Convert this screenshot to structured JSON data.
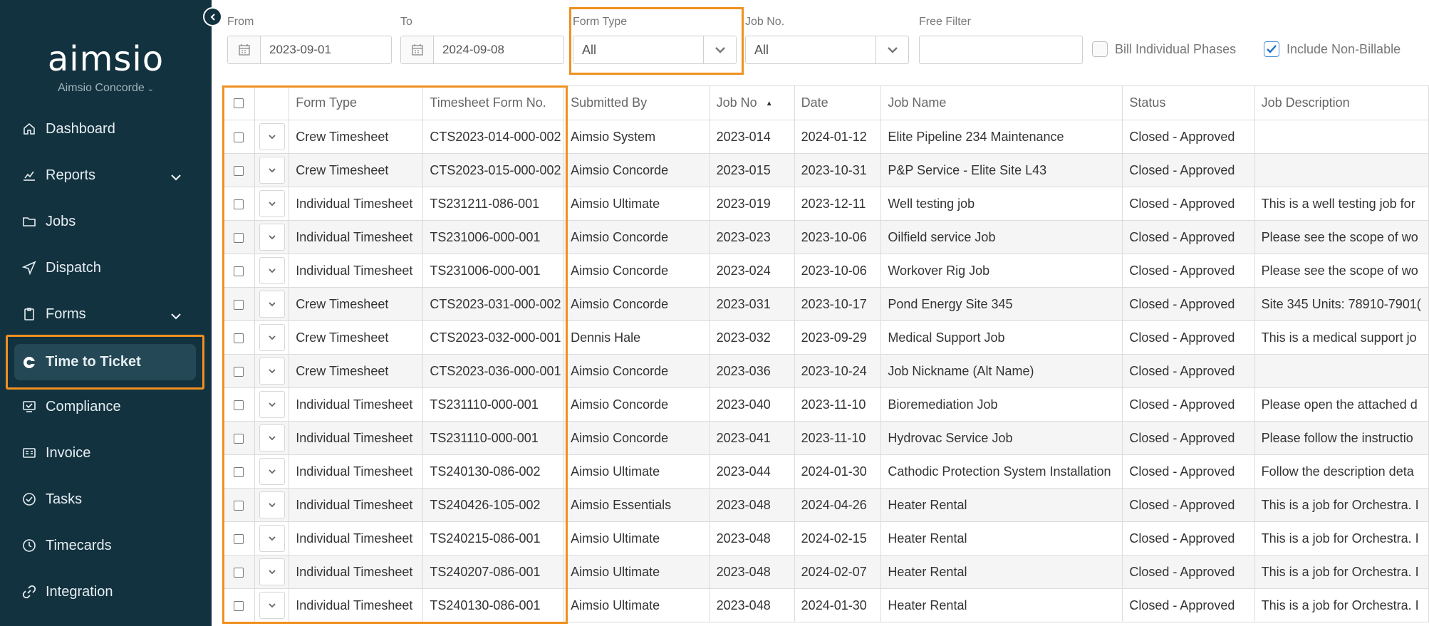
{
  "sidebar": {
    "logo": "aimsio",
    "company": "Aimsio Concorde",
    "items": [
      {
        "label": "Dashboard",
        "icon": "home-icon"
      },
      {
        "label": "Reports",
        "icon": "chart-icon"
      },
      {
        "label": "Jobs",
        "icon": "folder-icon"
      },
      {
        "label": "Dispatch",
        "icon": "send-icon"
      },
      {
        "label": "Forms",
        "icon": "clipboard-icon"
      },
      {
        "label": "Time to Ticket",
        "icon": "time-to-ticket-icon"
      },
      {
        "label": "Compliance",
        "icon": "compliance-icon"
      },
      {
        "label": "Invoice",
        "icon": "invoice-icon"
      },
      {
        "label": "Tasks",
        "icon": "check-circle-icon"
      },
      {
        "label": "Timecards",
        "icon": "clock-icon"
      },
      {
        "label": "Integration",
        "icon": "link-icon"
      }
    ]
  },
  "filters": {
    "from_label": "From",
    "from_value": "2023-09-01",
    "to_label": "To",
    "to_value": "2024-09-08",
    "form_type_label": "Form Type",
    "form_type_value": "All",
    "job_no_label": "Job No.",
    "job_no_value": "All",
    "free_filter_label": "Free Filter",
    "free_filter_value": "",
    "bill_individual_phases": "Bill Individual Phases",
    "include_non_billable": "Include Non-Billable"
  },
  "table": {
    "headers": [
      "Form Type",
      "Timesheet Form No.",
      "Submitted By",
      "Job No",
      "Date",
      "Job Name",
      "Status",
      "Job Description"
    ],
    "sorted_column": "Job No",
    "rows": [
      [
        "Crew Timesheet",
        "CTS2023-014-000-002",
        "Aimsio System",
        "2023-014",
        "2024-01-12",
        "Elite Pipeline 234 Maintenance",
        "Closed - Approved",
        ""
      ],
      [
        "Crew Timesheet",
        "CTS2023-015-000-002",
        "Aimsio Concorde",
        "2023-015",
        "2023-10-31",
        "P&P Service - Elite Site L43",
        "Closed - Approved",
        ""
      ],
      [
        "Individual Timesheet",
        "TS231211-086-001",
        "Aimsio Ultimate",
        "2023-019",
        "2023-12-11",
        "Well testing job",
        "Closed - Approved",
        "This is a well testing job for"
      ],
      [
        "Individual Timesheet",
        "TS231006-000-001",
        "Aimsio Concorde",
        "2023-023",
        "2023-10-06",
        "Oilfield service Job",
        "Closed - Approved",
        "Please see the scope of wo"
      ],
      [
        "Individual Timesheet",
        "TS231006-000-001",
        "Aimsio Concorde",
        "2023-024",
        "2023-10-06",
        "Workover Rig Job",
        "Closed - Approved",
        "Please see the scope of wo"
      ],
      [
        "Crew Timesheet",
        "CTS2023-031-000-002",
        "Aimsio Concorde",
        "2023-031",
        "2023-10-17",
        "Pond Energy Site 345",
        "Closed - Approved",
        "Site 345 Units: 78910-7901("
      ],
      [
        "Crew Timesheet",
        "CTS2023-032-000-001",
        "Dennis Hale",
        "2023-032",
        "2023-09-29",
        "Medical Support Job",
        "Closed - Approved",
        "This is a medical support jo"
      ],
      [
        "Crew Timesheet",
        "CTS2023-036-000-001",
        "Aimsio Concorde",
        "2023-036",
        "2023-10-24",
        "Job Nickname (Alt Name)",
        "Closed - Approved",
        ""
      ],
      [
        "Individual Timesheet",
        "TS231110-000-001",
        "Aimsio Concorde",
        "2023-040",
        "2023-11-10",
        "Bioremediation Job",
        "Closed - Approved",
        "Please open the attached d"
      ],
      [
        "Individual Timesheet",
        "TS231110-000-001",
        "Aimsio Concorde",
        "2023-041",
        "2023-11-10",
        "Hydrovac Service Job",
        "Closed - Approved",
        "Please follow the instructio"
      ],
      [
        "Individual Timesheet",
        "TS240130-086-002",
        "Aimsio Ultimate",
        "2023-044",
        "2024-01-30",
        "Cathodic Protection System Installation",
        "Closed - Approved",
        "Follow the description deta"
      ],
      [
        "Individual Timesheet",
        "TS240426-105-002",
        "Aimsio Essentials",
        "2023-048",
        "2024-04-26",
        "Heater Rental",
        "Closed - Approved",
        "This is a job for Orchestra. I"
      ],
      [
        "Individual Timesheet",
        "TS240215-086-001",
        "Aimsio Ultimate",
        "2023-048",
        "2024-02-15",
        "Heater Rental",
        "Closed - Approved",
        "This is a job for Orchestra. I"
      ],
      [
        "Individual Timesheet",
        "TS240207-086-001",
        "Aimsio Ultimate",
        "2023-048",
        "2024-02-07",
        "Heater Rental",
        "Closed - Approved",
        "This is a job for Orchestra. I"
      ],
      [
        "Individual Timesheet",
        "TS240130-086-001",
        "Aimsio Ultimate",
        "2023-048",
        "2024-01-30",
        "Heater Rental",
        "Closed - Approved",
        "This is a job for Orchestra. I"
      ]
    ]
  },
  "colors": {
    "sidebar_bg": "#13323f",
    "active_item_bg": "#244855",
    "highlight_outline": "#f0901f",
    "row_alt_bg": "#f5f5f5"
  }
}
